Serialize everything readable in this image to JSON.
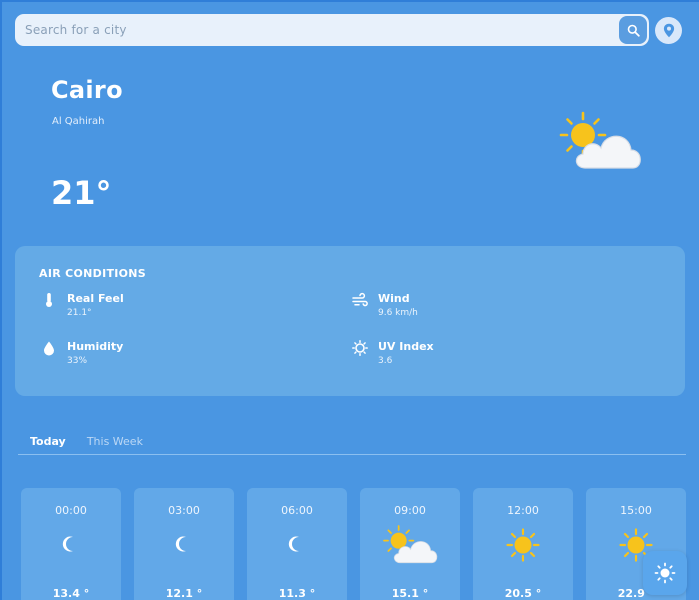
{
  "search": {
    "placeholder": "Search for a city",
    "icon": "search-icon"
  },
  "location_button": {
    "icon": "location-pin-icon"
  },
  "current": {
    "city": "Cairo",
    "region": "Al Qahirah",
    "temperature": "21°",
    "icon": "partly-cloudy-day-icon"
  },
  "air_conditions": {
    "title": "AIR CONDITIONS",
    "items": [
      {
        "label": "Real Feel",
        "value": "21.1°",
        "icon": "thermometer-icon"
      },
      {
        "label": "Wind",
        "value": "9.6 km/h",
        "icon": "wind-icon"
      },
      {
        "label": "Humidity",
        "value": "33%",
        "icon": "droplet-icon"
      },
      {
        "label": "UV Index",
        "value": "3.6",
        "icon": "sun-outline-icon"
      }
    ]
  },
  "tabs": [
    {
      "label": "Today",
      "active": true
    },
    {
      "label": "This Week",
      "active": false
    }
  ],
  "hourly": [
    {
      "time": "00:00",
      "temp": "13.4 °",
      "icon": "moon-icon"
    },
    {
      "time": "03:00",
      "temp": "12.1 °",
      "icon": "moon-icon"
    },
    {
      "time": "06:00",
      "temp": "11.3 °",
      "icon": "moon-icon"
    },
    {
      "time": "09:00",
      "temp": "15.1 °",
      "icon": "partly-cloudy-day-icon"
    },
    {
      "time": "12:00",
      "temp": "20.5 °",
      "icon": "sun-icon"
    },
    {
      "time": "15:00",
      "temp": "22.9 °",
      "icon": "sun-icon"
    }
  ],
  "theme_toggle": {
    "icon": "sun-theme-icon"
  },
  "colors": {
    "background": "#4a96e2",
    "panel": "#64aae6",
    "card": "#62a8e8",
    "sun": "#f7c31c",
    "cloud": "#f4f6f9"
  }
}
